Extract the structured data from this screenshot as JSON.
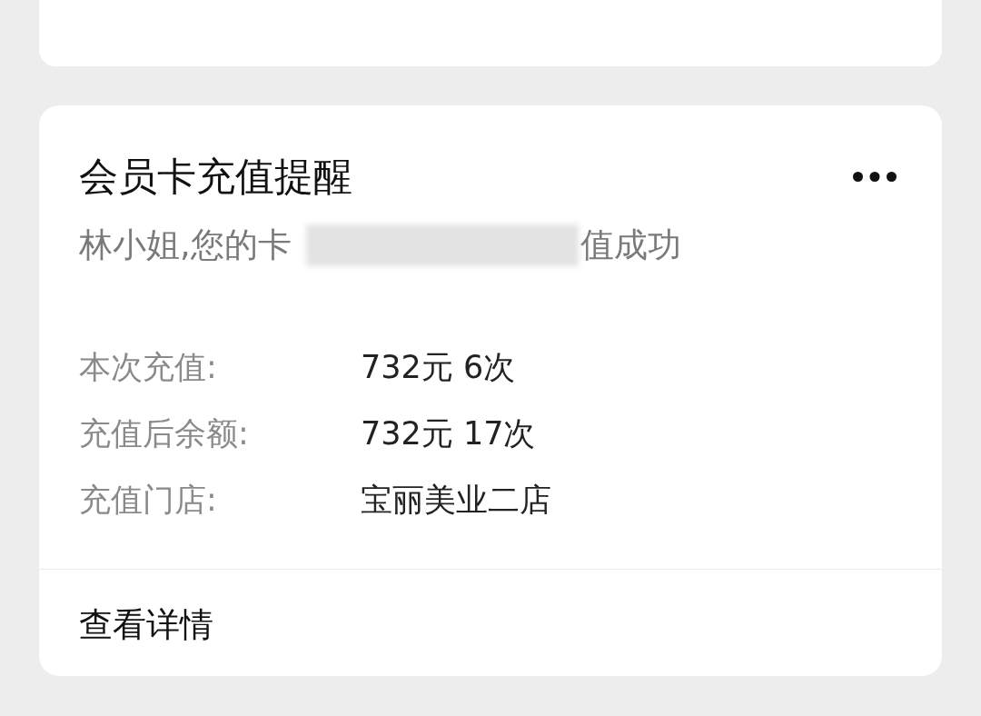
{
  "card": {
    "title": "会员卡充值提醒",
    "message": {
      "before": "林小姐,您的卡",
      "after": "值成功"
    },
    "details": [
      {
        "label": "本次充值:",
        "value": "732元 6次"
      },
      {
        "label": "充值后余额:",
        "value": "732元 17次"
      },
      {
        "label": "充值门店:",
        "value": "宝丽美业二店"
      }
    ],
    "link": "查看详情"
  }
}
